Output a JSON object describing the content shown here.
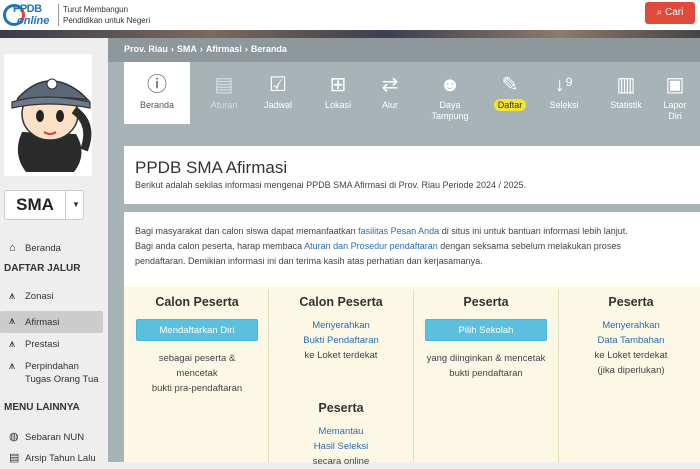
{
  "header": {
    "logo_top": "PPDB",
    "logo_bottom": "online",
    "tagline_1": "Turut Membangun",
    "tagline_2": "Pendidikan untuk Negeri",
    "search_label": "Cari",
    "search_icon": "search-icon"
  },
  "breadcrumb": [
    "Prov. Riau",
    "SMA",
    "Afirmasi",
    "Beranda"
  ],
  "nav": [
    {
      "label": "Beranda",
      "icon": "info-circle-icon"
    },
    {
      "label": "Aturan",
      "icon": "book-icon"
    },
    {
      "label": "Jadwal",
      "icon": "calendar-check-icon"
    },
    {
      "label": "Lokasi",
      "icon": "signpost-icon"
    },
    {
      "label": "Alur",
      "icon": "shuffle-icon"
    },
    {
      "label": "Daya Tampung",
      "icon": "users-icon"
    },
    {
      "label": "Daftar",
      "icon": "pencil-icon"
    },
    {
      "label": "Seleksi",
      "icon": "sort-numeric-icon"
    },
    {
      "label": "Statistik",
      "icon": "bar-chart-icon"
    },
    {
      "label": "Lapor Diri",
      "icon": "id-card-icon"
    }
  ],
  "sidebar": {
    "level": "SMA",
    "home": "Beranda",
    "jalur_head": "DAFTAR JALUR",
    "jalur": [
      "Zonasi",
      "Afirmasi",
      "Prestasi",
      "Perpindahan Tugas Orang Tua"
    ],
    "menu_head": "MENU LAINNYA",
    "menu": [
      "Sebaran NUN",
      "Arsip Tahun Lalu"
    ]
  },
  "page": {
    "title": "PPDB SMA Afirmasi",
    "subtitle": "Berikut adalah sekilas informasi mengenai PPDB SMA Afirmasi di Prov. Riau Periode 2024 / 2025.",
    "info_1a": "Bagi masyarakat dan calon siswa dapat memanfaatkan ",
    "info_1link": "fasilitas Pesan Anda",
    "info_1b": " di situs ini untuk bantuan informasi lebih lanjut.",
    "info_2a": "Bagi anda calon peserta, harap membaca ",
    "info_2link": "Aturan dan Prosedur pendaftaran",
    "info_2b": " dengan seksama sebelum melakukan proses",
    "info_3": "pendaftaran. Demikian informasi ini dan terima kasih atas perhatian dan kerjasamanya."
  },
  "steps": [
    {
      "heading": "Calon Peserta",
      "button": "Mendaftarkan Diri",
      "text_1": "sebagai peserta &",
      "text_2": "mencetak",
      "text_3": "bukti pra-pendaftaran"
    },
    {
      "heading": "Calon Peserta",
      "link_1": "Menyerahkan",
      "link_2": "Bukti Pendaftaran",
      "text_1": "ke Loket terdekat"
    },
    {
      "heading": "Peserta",
      "button": "Pilih Sekolah",
      "text_1": "yang diinginkan & mencetak",
      "text_2": "bukti pendaftaran"
    },
    {
      "heading": "Peserta",
      "link_1": "Menyerahkan",
      "link_2": "Data Tambahan",
      "text_1": "ke Loket terdekat",
      "text_2": "(jika diperlukan)"
    },
    {
      "heading": "Peserta",
      "link_1": "Memantau",
      "link_2": "Hasil Seleksi",
      "text_1": "secara online"
    }
  ]
}
